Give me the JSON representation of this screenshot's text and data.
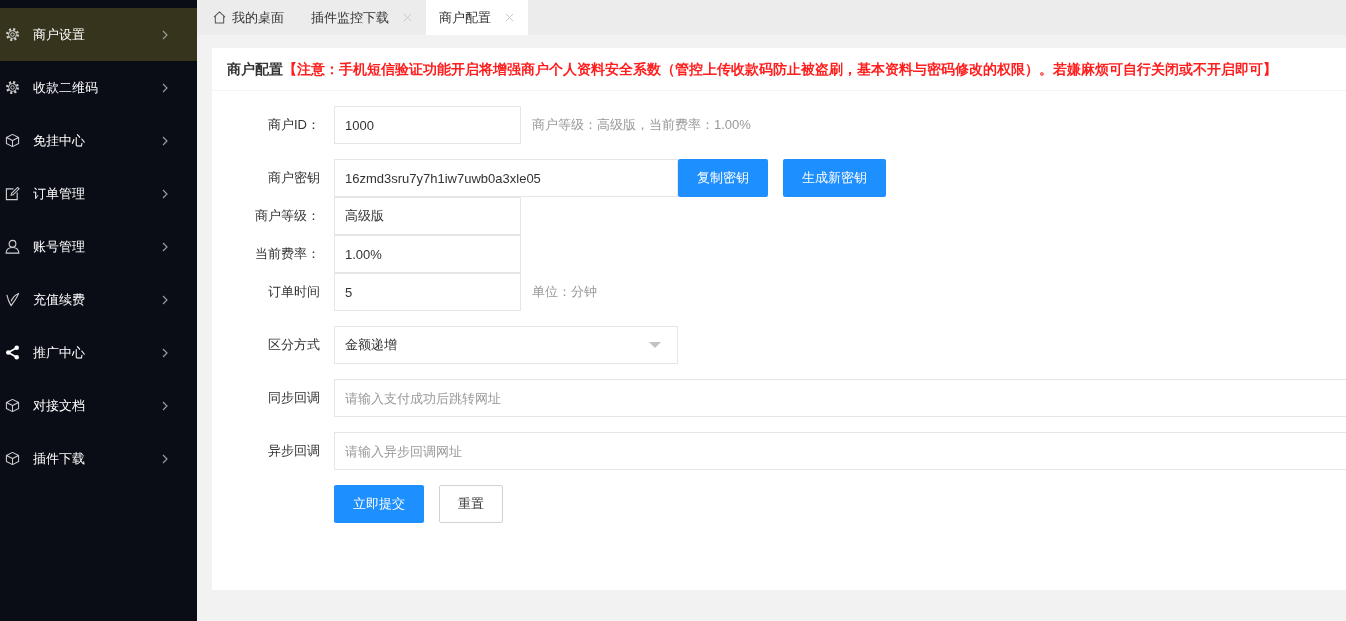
{
  "sidebar": {
    "items": [
      {
        "label": "商户设置",
        "kind": "gear",
        "selected": true
      },
      {
        "label": "收款二维码",
        "kind": "gear",
        "selected": false
      },
      {
        "label": "免挂中心",
        "kind": "cube",
        "selected": false
      },
      {
        "label": "订单管理",
        "kind": "edit",
        "selected": false
      },
      {
        "label": "账号管理",
        "kind": "user",
        "selected": false
      },
      {
        "label": "充值续费",
        "kind": "check",
        "selected": false
      },
      {
        "label": "推广中心",
        "kind": "share",
        "selected": false
      },
      {
        "label": "对接文档",
        "kind": "cube",
        "selected": false
      },
      {
        "label": "插件下载",
        "kind": "cube",
        "selected": false
      }
    ]
  },
  "tabs": [
    {
      "label": "我的桌面",
      "kind": "home",
      "selected": false
    },
    {
      "label": "插件监控下载",
      "kind": "page",
      "selected": false
    },
    {
      "label": "商户配置",
      "kind": "page",
      "selected": true
    }
  ],
  "card": {
    "title": "商户配置",
    "notice": "【注意：手机短信验证功能开启将增强商户个人资料安全系数（管控上传收款码防止被盗刷，基本资料与密码修改的权限）。若嫌麻烦可自行关闭或不开启即可】",
    "field_groups": [
      {
        "fields": [
          {
            "kind": "short",
            "label": "商户ID：",
            "value": "1000",
            "hint": "商户等级：高级版，当前费率：1.00%"
          }
        ]
      },
      {
        "fields": [
          {
            "kind": "key",
            "label": "商户密钥",
            "value": "16zmd3sru7y7h1iw7uwb0a3xle05",
            "buttons": [
              "复制密钥",
              "生成新密钥"
            ]
          },
          {
            "kind": "short",
            "label": "商户等级：",
            "value": "高级版"
          },
          {
            "kind": "short",
            "label": "当前费率：",
            "value": "1.00%"
          },
          {
            "kind": "short",
            "label": "订单时间",
            "value": "5",
            "hint": "单位：分钟"
          }
        ]
      },
      {
        "fields": [
          {
            "kind": "select",
            "label": "区分方式",
            "value": "金额递增"
          }
        ]
      },
      {
        "fields": [
          {
            "kind": "long",
            "label": "同步回调",
            "placeholder": "请输入支付成功后跳转网址"
          }
        ]
      },
      {
        "fields": [
          {
            "kind": "long",
            "label": "异步回调",
            "placeholder": "请输入异步回调网址"
          }
        ]
      }
    ],
    "actions": [
      {
        "label": "立即提交",
        "kind": "submit"
      },
      {
        "label": "重置",
        "kind": "reset"
      }
    ]
  }
}
